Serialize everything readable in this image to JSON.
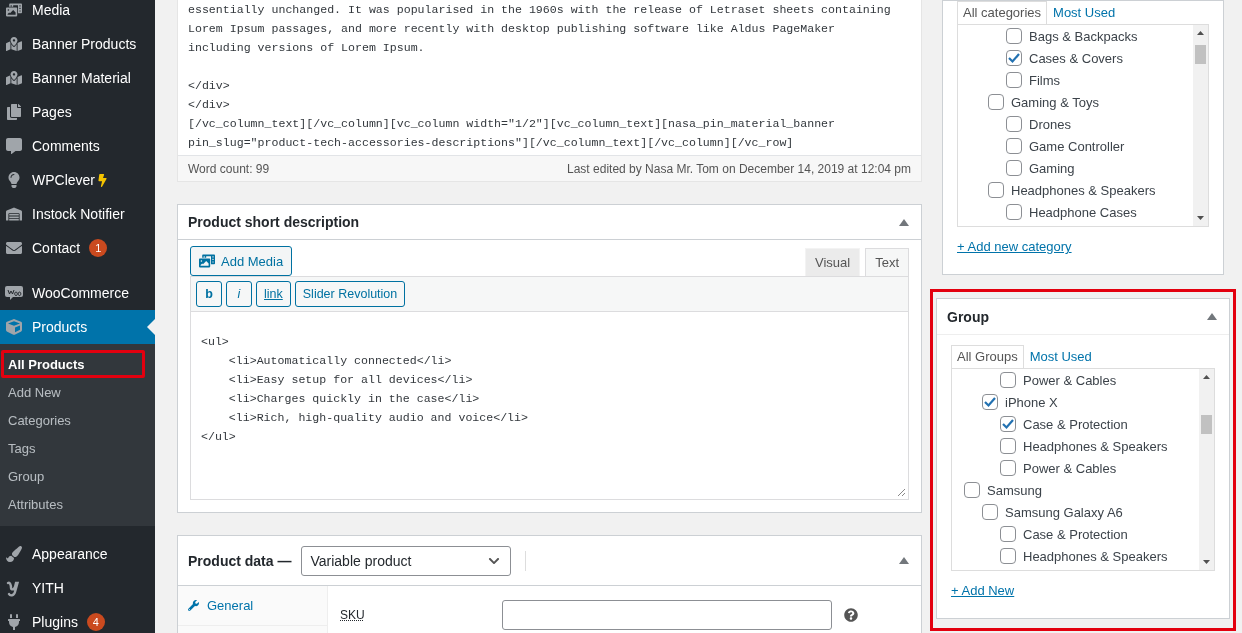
{
  "sidebar": {
    "sections": [
      {
        "items": [
          {
            "label": "Media",
            "current": false
          },
          {
            "label": "Banner Products",
            "current": false
          },
          {
            "label": "Banner Material",
            "current": false
          },
          {
            "label": "Pages",
            "current": false
          },
          {
            "label": "Comments",
            "current": false
          },
          {
            "label": "WPClever",
            "current": false
          },
          {
            "label": "Instock Notifier",
            "current": false
          },
          {
            "label": "Contact",
            "current": false,
            "badge": "1"
          }
        ]
      },
      {
        "items": [
          {
            "label": "WooCommerce",
            "current": false
          },
          {
            "label": "Products",
            "current": true,
            "children": [
              {
                "label": "All Products",
                "current": true,
                "annotated": true
              },
              {
                "label": "Add New",
                "current": false,
                "annotated": false
              },
              {
                "label": "Categories",
                "current": false,
                "annotated": false
              },
              {
                "label": "Tags",
                "current": false,
                "annotated": false
              },
              {
                "label": "Group",
                "current": false,
                "annotated": false
              },
              {
                "label": "Attributes",
                "current": false,
                "annotated": false
              }
            ]
          }
        ]
      },
      {
        "items": [
          {
            "label": "Appearance",
            "current": false
          },
          {
            "label": "YITH",
            "current": false
          },
          {
            "label": "Plugins",
            "current": false,
            "badge": "4"
          }
        ]
      }
    ]
  },
  "editor": {
    "code_blocks": [
      [
        "essentially unchanged. It was popularised in the 1960s with the release of Letraset sheets containing",
        "Lorem Ipsum passages, and more recently with desktop publishing software like Aldus PageMaker",
        "including versions of Lorem Ipsum."
      ],
      [
        "</div>",
        "</div>",
        "[/vc_column_text][/vc_column][vc_column width=\"1/2\"][vc_column_text][nasa_pin_material_banner",
        "pin_slug=\"product-tech-accessories-descriptions\"][/vc_column_text][/vc_column][/vc_row]"
      ]
    ],
    "word_count": "Word count: 99",
    "last_edited": "Last edited by Nasa Mr. Tom on December 14, 2019 at 12:04 pm"
  },
  "short_description": {
    "title": "Product short description",
    "add_media": "Add Media",
    "tabs": [
      {
        "label": "Visual",
        "selected": false
      },
      {
        "label": "Text",
        "selected": true
      }
    ],
    "quicktags": [
      {
        "label": "b",
        "kind": "bold"
      },
      {
        "label": "i",
        "kind": "italic"
      },
      {
        "label": "link",
        "kind": "link"
      },
      {
        "label": "Slider Revolution",
        "kind": "plain"
      }
    ],
    "code_lines": [
      "<ul>",
      "    <li>Automatically connected</li>",
      "    <li>Easy setup for all devices</li>",
      "    <li>Charges quickly in the case</li>",
      "    <li>Rich, high-quality audio and voice</li>",
      "</ul>"
    ]
  },
  "product_data": {
    "title": "Product data —",
    "product_type": "Variable product",
    "tabs": [
      {
        "label": "General",
        "selected": false
      }
    ],
    "fields": [
      {
        "label": "SKU"
      }
    ]
  },
  "categories": {
    "tabs": [
      {
        "label": "All categories",
        "selected": true
      },
      {
        "label": "Most Used",
        "selected": false
      }
    ],
    "items": [
      {
        "children": [
          {
            "children": [
              {
                "label": "Bags & Backpacks",
                "checked": false
              },
              {
                "label": "Cases & Covers",
                "checked": true
              },
              {
                "label": "Films",
                "checked": false
              }
            ]
          },
          {
            "label": "Gaming & Toys",
            "checked": false,
            "children": [
              {
                "label": "Drones",
                "checked": false
              },
              {
                "label": "Game Controller",
                "checked": false
              },
              {
                "label": "Gaming",
                "checked": false
              }
            ]
          },
          {
            "label": "Headphones & Speakers",
            "checked": false,
            "children": [
              {
                "label": "Headphone Cases",
                "checked": false
              }
            ]
          }
        ]
      }
    ],
    "add_link": "+ Add new category"
  },
  "group_panel": {
    "title": "Group",
    "annotated": true,
    "tabs": [
      {
        "label": "All Groups",
        "selected": true
      },
      {
        "label": "Most Used",
        "selected": false
      }
    ],
    "items": [
      {
        "children": [
          {
            "children": [
              {
                "label": "Power & Cables",
                "checked": false
              }
            ]
          },
          {
            "label": "iPhone X",
            "checked": true,
            "children": [
              {
                "label": "Case & Protection",
                "checked": true
              },
              {
                "label": "Headphones & Speakers",
                "checked": false
              },
              {
                "label": "Power & Cables",
                "checked": false
              }
            ]
          }
        ]
      },
      {
        "label": "Samsung",
        "checked": false,
        "children": [
          {
            "label": "Samsung Galaxy A6",
            "checked": false,
            "children": [
              {
                "label": "Case & Protection",
                "checked": false
              },
              {
                "label": "Headphones & Speakers",
                "checked": false
              }
            ]
          }
        ]
      }
    ],
    "add_link": "+ Add New"
  }
}
